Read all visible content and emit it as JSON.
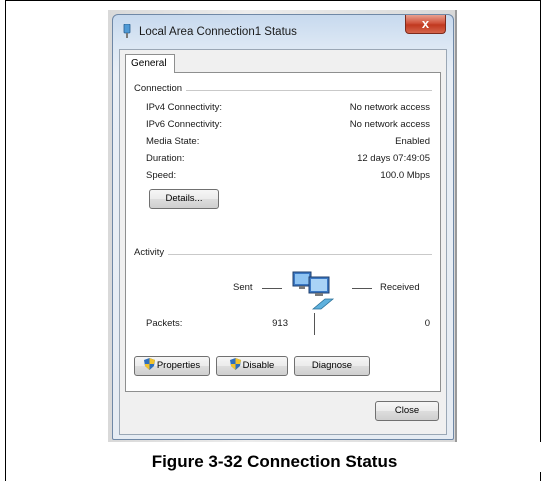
{
  "window": {
    "title": "Local Area Connection1 Status",
    "close_glyph": "x"
  },
  "tabs": [
    {
      "label": "General",
      "selected": true
    }
  ],
  "connection": {
    "group_label": "Connection",
    "rows": [
      {
        "label": "IPv4 Connectivity:",
        "value": "No network access"
      },
      {
        "label": "IPv6 Connectivity:",
        "value": "No network access"
      },
      {
        "label": "Media State:",
        "value": "Enabled"
      },
      {
        "label": "Duration:",
        "value": "12 days 07:49:05"
      },
      {
        "label": "Speed:",
        "value": "100.0 Mbps"
      }
    ],
    "details_button": "Details..."
  },
  "activity": {
    "group_label": "Activity",
    "sent_label": "Sent",
    "received_label": "Received",
    "packets_label": "Packets:",
    "packets_sent": "913",
    "packets_received": "0"
  },
  "buttons": {
    "properties": "Properties",
    "disable": "Disable",
    "diagnose": "Diagnose",
    "close": "Close"
  },
  "caption": "Figure 3-32 Connection Status",
  "colors": {
    "accent": "#2b5f9e",
    "close_button": "#c7422a"
  }
}
